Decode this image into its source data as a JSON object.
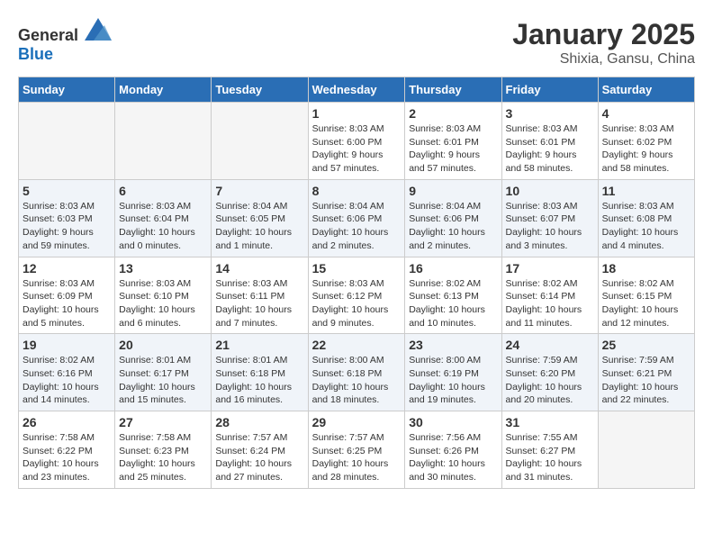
{
  "header": {
    "logo": {
      "text_general": "General",
      "text_blue": "Blue"
    },
    "title": "January 2025",
    "subtitle": "Shixia, Gansu, China"
  },
  "weekdays": [
    "Sunday",
    "Monday",
    "Tuesday",
    "Wednesday",
    "Thursday",
    "Friday",
    "Saturday"
  ],
  "weeks": [
    [
      {
        "day": "",
        "info": ""
      },
      {
        "day": "",
        "info": ""
      },
      {
        "day": "",
        "info": ""
      },
      {
        "day": "1",
        "info": "Sunrise: 8:03 AM\nSunset: 6:00 PM\nDaylight: 9 hours\nand 57 minutes."
      },
      {
        "day": "2",
        "info": "Sunrise: 8:03 AM\nSunset: 6:01 PM\nDaylight: 9 hours\nand 57 minutes."
      },
      {
        "day": "3",
        "info": "Sunrise: 8:03 AM\nSunset: 6:01 PM\nDaylight: 9 hours\nand 58 minutes."
      },
      {
        "day": "4",
        "info": "Sunrise: 8:03 AM\nSunset: 6:02 PM\nDaylight: 9 hours\nand 58 minutes."
      }
    ],
    [
      {
        "day": "5",
        "info": "Sunrise: 8:03 AM\nSunset: 6:03 PM\nDaylight: 9 hours\nand 59 minutes."
      },
      {
        "day": "6",
        "info": "Sunrise: 8:03 AM\nSunset: 6:04 PM\nDaylight: 10 hours\nand 0 minutes."
      },
      {
        "day": "7",
        "info": "Sunrise: 8:04 AM\nSunset: 6:05 PM\nDaylight: 10 hours\nand 1 minute."
      },
      {
        "day": "8",
        "info": "Sunrise: 8:04 AM\nSunset: 6:06 PM\nDaylight: 10 hours\nand 2 minutes."
      },
      {
        "day": "9",
        "info": "Sunrise: 8:04 AM\nSunset: 6:06 PM\nDaylight: 10 hours\nand 2 minutes."
      },
      {
        "day": "10",
        "info": "Sunrise: 8:03 AM\nSunset: 6:07 PM\nDaylight: 10 hours\nand 3 minutes."
      },
      {
        "day": "11",
        "info": "Sunrise: 8:03 AM\nSunset: 6:08 PM\nDaylight: 10 hours\nand 4 minutes."
      }
    ],
    [
      {
        "day": "12",
        "info": "Sunrise: 8:03 AM\nSunset: 6:09 PM\nDaylight: 10 hours\nand 5 minutes."
      },
      {
        "day": "13",
        "info": "Sunrise: 8:03 AM\nSunset: 6:10 PM\nDaylight: 10 hours\nand 6 minutes."
      },
      {
        "day": "14",
        "info": "Sunrise: 8:03 AM\nSunset: 6:11 PM\nDaylight: 10 hours\nand 7 minutes."
      },
      {
        "day": "15",
        "info": "Sunrise: 8:03 AM\nSunset: 6:12 PM\nDaylight: 10 hours\nand 9 minutes."
      },
      {
        "day": "16",
        "info": "Sunrise: 8:02 AM\nSunset: 6:13 PM\nDaylight: 10 hours\nand 10 minutes."
      },
      {
        "day": "17",
        "info": "Sunrise: 8:02 AM\nSunset: 6:14 PM\nDaylight: 10 hours\nand 11 minutes."
      },
      {
        "day": "18",
        "info": "Sunrise: 8:02 AM\nSunset: 6:15 PM\nDaylight: 10 hours\nand 12 minutes."
      }
    ],
    [
      {
        "day": "19",
        "info": "Sunrise: 8:02 AM\nSunset: 6:16 PM\nDaylight: 10 hours\nand 14 minutes."
      },
      {
        "day": "20",
        "info": "Sunrise: 8:01 AM\nSunset: 6:17 PM\nDaylight: 10 hours\nand 15 minutes."
      },
      {
        "day": "21",
        "info": "Sunrise: 8:01 AM\nSunset: 6:18 PM\nDaylight: 10 hours\nand 16 minutes."
      },
      {
        "day": "22",
        "info": "Sunrise: 8:00 AM\nSunset: 6:18 PM\nDaylight: 10 hours\nand 18 minutes."
      },
      {
        "day": "23",
        "info": "Sunrise: 8:00 AM\nSunset: 6:19 PM\nDaylight: 10 hours\nand 19 minutes."
      },
      {
        "day": "24",
        "info": "Sunrise: 7:59 AM\nSunset: 6:20 PM\nDaylight: 10 hours\nand 20 minutes."
      },
      {
        "day": "25",
        "info": "Sunrise: 7:59 AM\nSunset: 6:21 PM\nDaylight: 10 hours\nand 22 minutes."
      }
    ],
    [
      {
        "day": "26",
        "info": "Sunrise: 7:58 AM\nSunset: 6:22 PM\nDaylight: 10 hours\nand 23 minutes."
      },
      {
        "day": "27",
        "info": "Sunrise: 7:58 AM\nSunset: 6:23 PM\nDaylight: 10 hours\nand 25 minutes."
      },
      {
        "day": "28",
        "info": "Sunrise: 7:57 AM\nSunset: 6:24 PM\nDaylight: 10 hours\nand 27 minutes."
      },
      {
        "day": "29",
        "info": "Sunrise: 7:57 AM\nSunset: 6:25 PM\nDaylight: 10 hours\nand 28 minutes."
      },
      {
        "day": "30",
        "info": "Sunrise: 7:56 AM\nSunset: 6:26 PM\nDaylight: 10 hours\nand 30 minutes."
      },
      {
        "day": "31",
        "info": "Sunrise: 7:55 AM\nSunset: 6:27 PM\nDaylight: 10 hours\nand 31 minutes."
      },
      {
        "day": "",
        "info": ""
      }
    ]
  ]
}
